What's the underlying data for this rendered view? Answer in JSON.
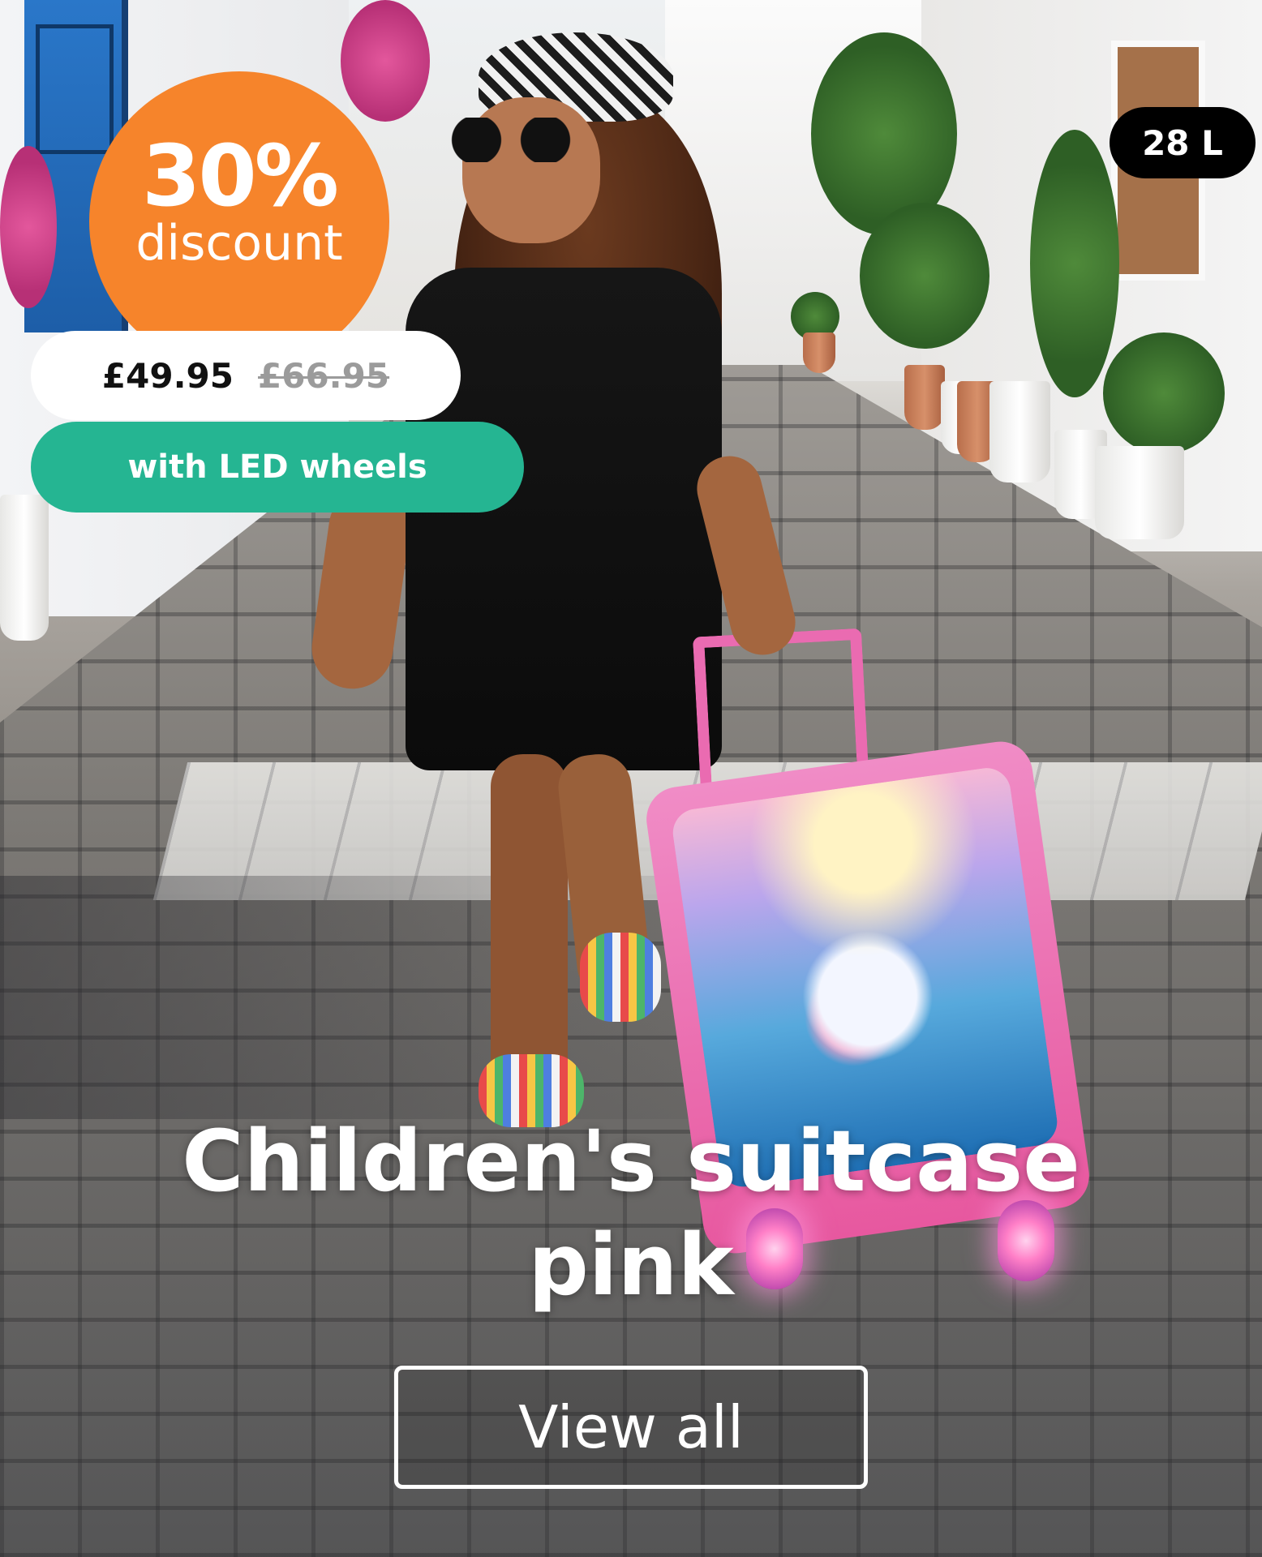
{
  "promo": {
    "discount_percent": "30%",
    "discount_label": "discount",
    "price_current": "£49.95",
    "price_original": "£66.95",
    "feature": "with LED wheels",
    "capacity": "28 L"
  },
  "product": {
    "title_line1": "Children's suitcase",
    "title_line2": "pink"
  },
  "cta": {
    "label": "View all"
  },
  "colors": {
    "discount_badge": "#f6842b",
    "feature_pill": "#25b592",
    "price_pill": "#ffffff",
    "capacity_badge": "#000000"
  }
}
